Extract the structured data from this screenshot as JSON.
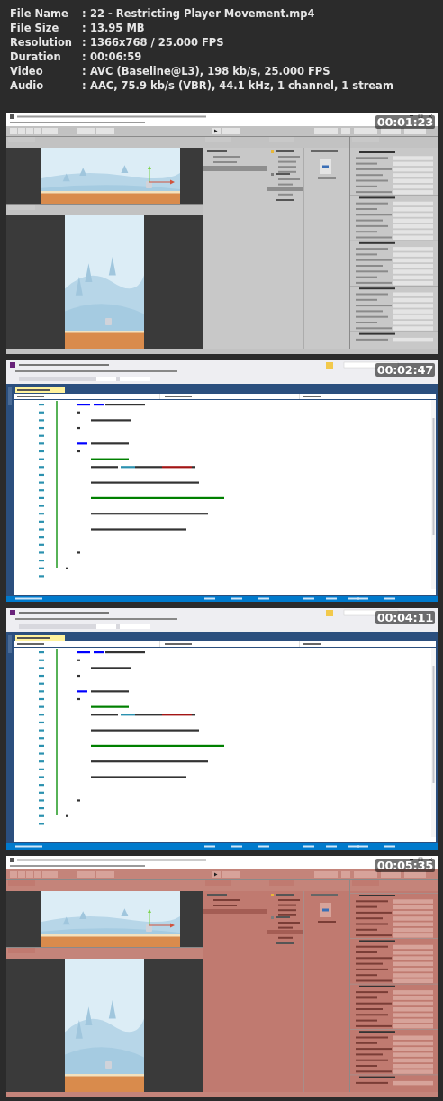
{
  "info": [
    {
      "label": "File Name",
      "colon": ":",
      "value": "22 - Restricting Player Movement.mp4"
    },
    {
      "label": "File Size",
      "colon": ":",
      "value": "13.95 MB"
    },
    {
      "label": "Resolution",
      "colon": ":",
      "value": "1366x768 / 25.000 FPS"
    },
    {
      "label": "Duration",
      "colon": ":",
      "value": "00:06:59"
    },
    {
      "label": "Video",
      "colon": ":",
      "value": "AVC (Baseline@L3), 198 kb/s, 25.000 FPS"
    },
    {
      "label": "Audio",
      "colon": ":",
      "value": "AAC, 75.9 kb/s (VBR), 44.1 kHz, 1 channel, 1 stream"
    }
  ],
  "frames": [
    {
      "kind": "unity",
      "timestamp": "00:01:23",
      "tinted": false
    },
    {
      "kind": "ide",
      "timestamp": "00:02:47"
    },
    {
      "kind": "ide",
      "timestamp": "00:04:11"
    },
    {
      "kind": "unity",
      "timestamp": "00:05:35",
      "tinted": true
    }
  ]
}
